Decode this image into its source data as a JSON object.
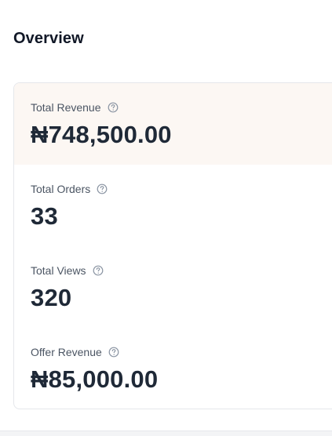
{
  "page": {
    "title": "Overview"
  },
  "metrics": [
    {
      "label": "Total Revenue",
      "value": "₦748,500.00",
      "active": true,
      "icon": "help-circle-icon"
    },
    {
      "label": "Total Orders",
      "value": "33",
      "active": false,
      "icon": "help-circle-icon"
    },
    {
      "label": "Total Views",
      "value": "320",
      "active": false,
      "icon": "help-circle-icon"
    },
    {
      "label": "Offer Revenue",
      "value": "₦85,000.00",
      "active": false,
      "icon": "help-circle-icon"
    }
  ],
  "colors": {
    "active_background": "#fcf7f3",
    "active_accent": "#e6a978",
    "text_primary": "#1f2937",
    "text_secondary": "#4b5563"
  }
}
